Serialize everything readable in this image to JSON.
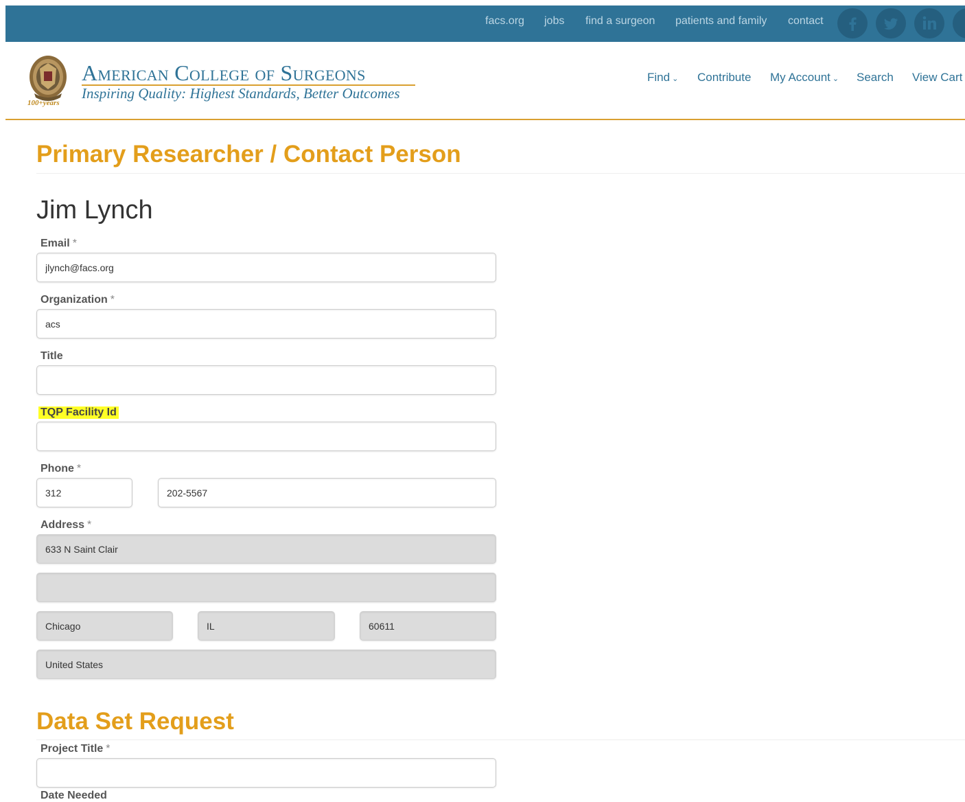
{
  "topbar": {
    "links": [
      "facs.org",
      "jobs",
      "find a surgeon",
      "patients and family",
      "contact"
    ],
    "social": [
      "facebook-icon",
      "twitter-icon",
      "linkedin-icon",
      "instagram-icon"
    ]
  },
  "header": {
    "org_name": "American College of Surgeons",
    "tagline": "Inspiring Quality: Highest Standards, Better Outcomes",
    "years_badge": "100+years",
    "nav": [
      "Find",
      "Contribute",
      "My Account",
      "Search",
      "View Cart"
    ]
  },
  "contact_section": {
    "heading": "Primary Researcher / Contact Person",
    "person_name": "Jim Lynch",
    "email_label": "Email",
    "email_value": "jlynch@facs.org",
    "organization_label": "Organization",
    "organization_value": "acs",
    "title_label": "Title",
    "title_value": "",
    "tqp_label": "TQP Facility Id",
    "tqp_value": "",
    "phone_label": "Phone",
    "phone_area": "312",
    "phone_number": "202-5567",
    "address_label": "Address",
    "address_line1": "633 N Saint Clair",
    "address_line2": "",
    "city": "Chicago",
    "state": "IL",
    "zip": "60611",
    "country": "United States",
    "required_marker": "*"
  },
  "dataset_section": {
    "heading": "Data Set Request",
    "project_title_label": "Project Title",
    "project_title_value": "",
    "date_needed_label": "Date Needed"
  },
  "colors": {
    "topbar": "#2f7397",
    "brand_blue": "#2f7397",
    "accent_gold": "#e39e1b",
    "highlight": "#ffff26",
    "readonly_field": "#dcdcdc"
  }
}
